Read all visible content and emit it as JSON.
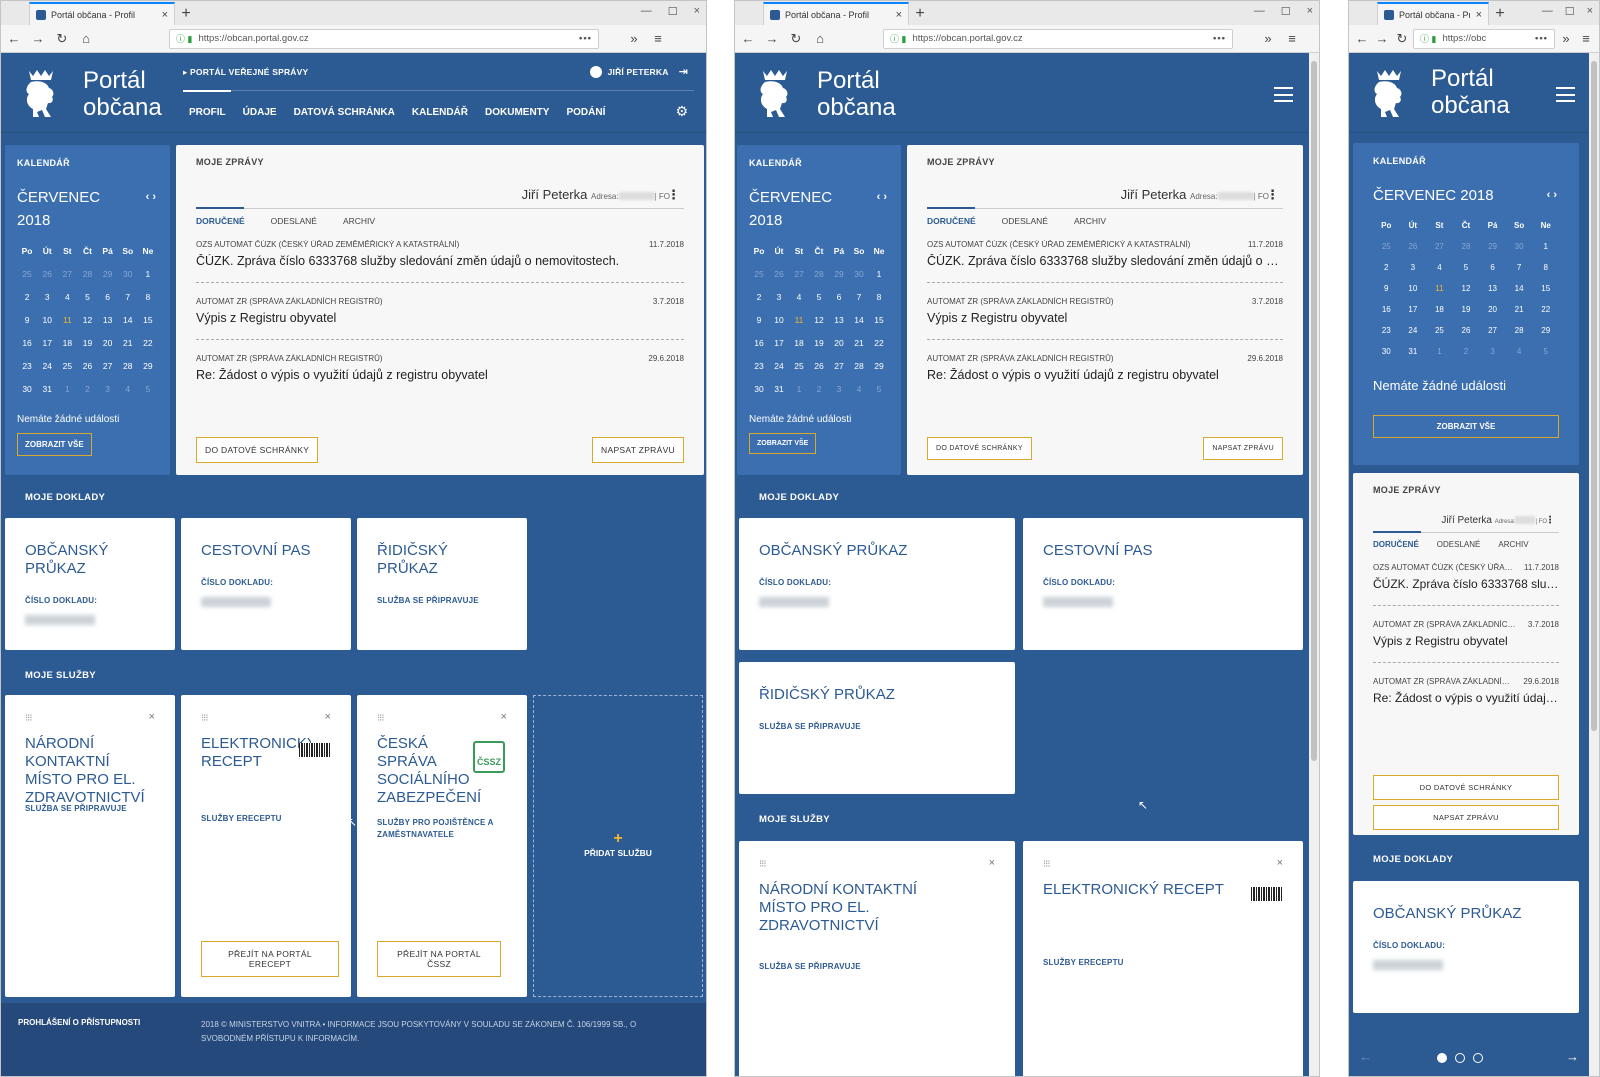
{
  "browser": {
    "tab_title": "Portál občana - Profil",
    "tab_title_short": "Portál občana - Pr",
    "url": "https://obcan.portal.gov.cz",
    "url_short": "https://obc",
    "url_dots": "•••"
  },
  "header": {
    "brand_line1": "Portál",
    "brand_line2": "občana",
    "top_link": "PORTÁL VEŘEJNÉ SPRÁVY",
    "user_name": "JIŘÍ PETERKA",
    "menu": [
      "PROFIL",
      "ÚDAJE",
      "DATOVÁ SCHRÁNKA",
      "KALENDÁŘ",
      "DOKUMENTY",
      "PODÁNÍ"
    ]
  },
  "calendar": {
    "title": "KALENDÁŘ",
    "month": "ČERVENEC 2018",
    "month_word": "ČERVENEC",
    "year": "2018",
    "nav": "‹ ›",
    "weekdays": [
      "Po",
      "Út",
      "St",
      "Čt",
      "Pá",
      "So",
      "Ne"
    ],
    "days": [
      "25",
      "26",
      "27",
      "28",
      "29",
      "30",
      "1",
      "2",
      "3",
      "4",
      "5",
      "6",
      "7",
      "8",
      "9",
      "10",
      "11",
      "12",
      "13",
      "14",
      "15",
      "16",
      "17",
      "18",
      "19",
      "20",
      "21",
      "22",
      "23",
      "24",
      "25",
      "26",
      "27",
      "28",
      "29",
      "30",
      "31",
      "1",
      "2",
      "3",
      "4",
      "5"
    ],
    "no_events": "Nemáte žádné události",
    "show_all": "ZOBRAZIT VŠE"
  },
  "messages": {
    "title": "MOJE ZPRÁVY",
    "user": "Jiří Peterka",
    "address_label": "Adresa:",
    "fo": "| FO",
    "tabs": [
      "DORUČENÉ",
      "ODESLANÉ",
      "ARCHIV"
    ],
    "items": [
      {
        "from": "OZS AUTOMAT ČÚZK (ČESKÝ ÚŘAD ZEMĚMĚŘICKÝ A KATASTRÁLNÍ)",
        "date": "11.7.2018",
        "subject": "ČÚZK. Zpráva číslo 6333768 služby sledování změn údajů o nemovitostech."
      },
      {
        "from": "AUTOMAT ZR (SPRÁVA ZÁKLADNÍCH REGISTRŮ)",
        "date": "3.7.2018",
        "subject": "Výpis z Registru obyvatel"
      },
      {
        "from": "AUTOMAT ZR (SPRÁVA ZÁKLADNÍCH REGISTRŮ)",
        "date": "29.6.2018",
        "subject": "Re: Žádost o výpis o využití údajů z registru obyvatel"
      }
    ],
    "btn_inbox": "DO DATOVÉ SCHRÁNKY",
    "btn_write": "NAPSAT ZPRÁVU"
  },
  "documents": {
    "title": "MOJE DOKLADY",
    "items": [
      {
        "name": "OBČANSKÝ PRŮKAZ",
        "label": "ČÍSLO DOKLADU:"
      },
      {
        "name": "CESTOVNÍ PAS",
        "label": "ČÍSLO DOKLADU:"
      },
      {
        "name": "ŘIDIČSKÝ PRŮKAZ",
        "label": "SLUŽBA SE PŘIPRAVUJE"
      }
    ]
  },
  "services": {
    "title": "MOJE SLUŽBY",
    "items": [
      {
        "name": "NÁRODNÍ KONTAKTNÍ MÍSTO PRO EL. ZDRAVOTNICTVÍ",
        "label": "SLUŽBA SE PŘIPRAVUJE"
      },
      {
        "name": "ELEKTRONICKÝ RECEPT",
        "label": "SLUŽBY ERECEPTU",
        "button": "PŘEJÍT NA PORTÁL ERECEPT"
      },
      {
        "name": "ČESKÁ SPRÁVA SOCIÁLNÍHO ZABEZPEČENÍ",
        "label": "SLUŽBY PRO POJIŠTĚNCE A ZAMĚSTNAVATELE",
        "button": "PŘEJÍT NA PORTÁL ČSSZ",
        "logo": "ČSSZ"
      }
    ],
    "add": "PŘIDAT SLUŽBU"
  },
  "footer": {
    "accessibility": "PROHLÁŠENÍ O PŘÍSTUPNOSTI",
    "copyright": "2018 © MINISTERSTVO VNITRA • INFORMACE JSOU POSKYTOVÁNY V SOULADU SE ZÁKONEM Č. 106/1999 SB., O SVOBODNÉM PŘÍSTUPU K INFORMACÍM."
  },
  "icons": {
    "back": "←",
    "forward": "→",
    "reload": "↻",
    "home": "⌂",
    "lock": "🔒",
    "more": "»",
    "menu": "≡",
    "close": "×",
    "plus": "+",
    "gear": "⚙",
    "logout": "⇥",
    "drag": "⁝⁝⁝",
    "kebab": "⋮"
  }
}
